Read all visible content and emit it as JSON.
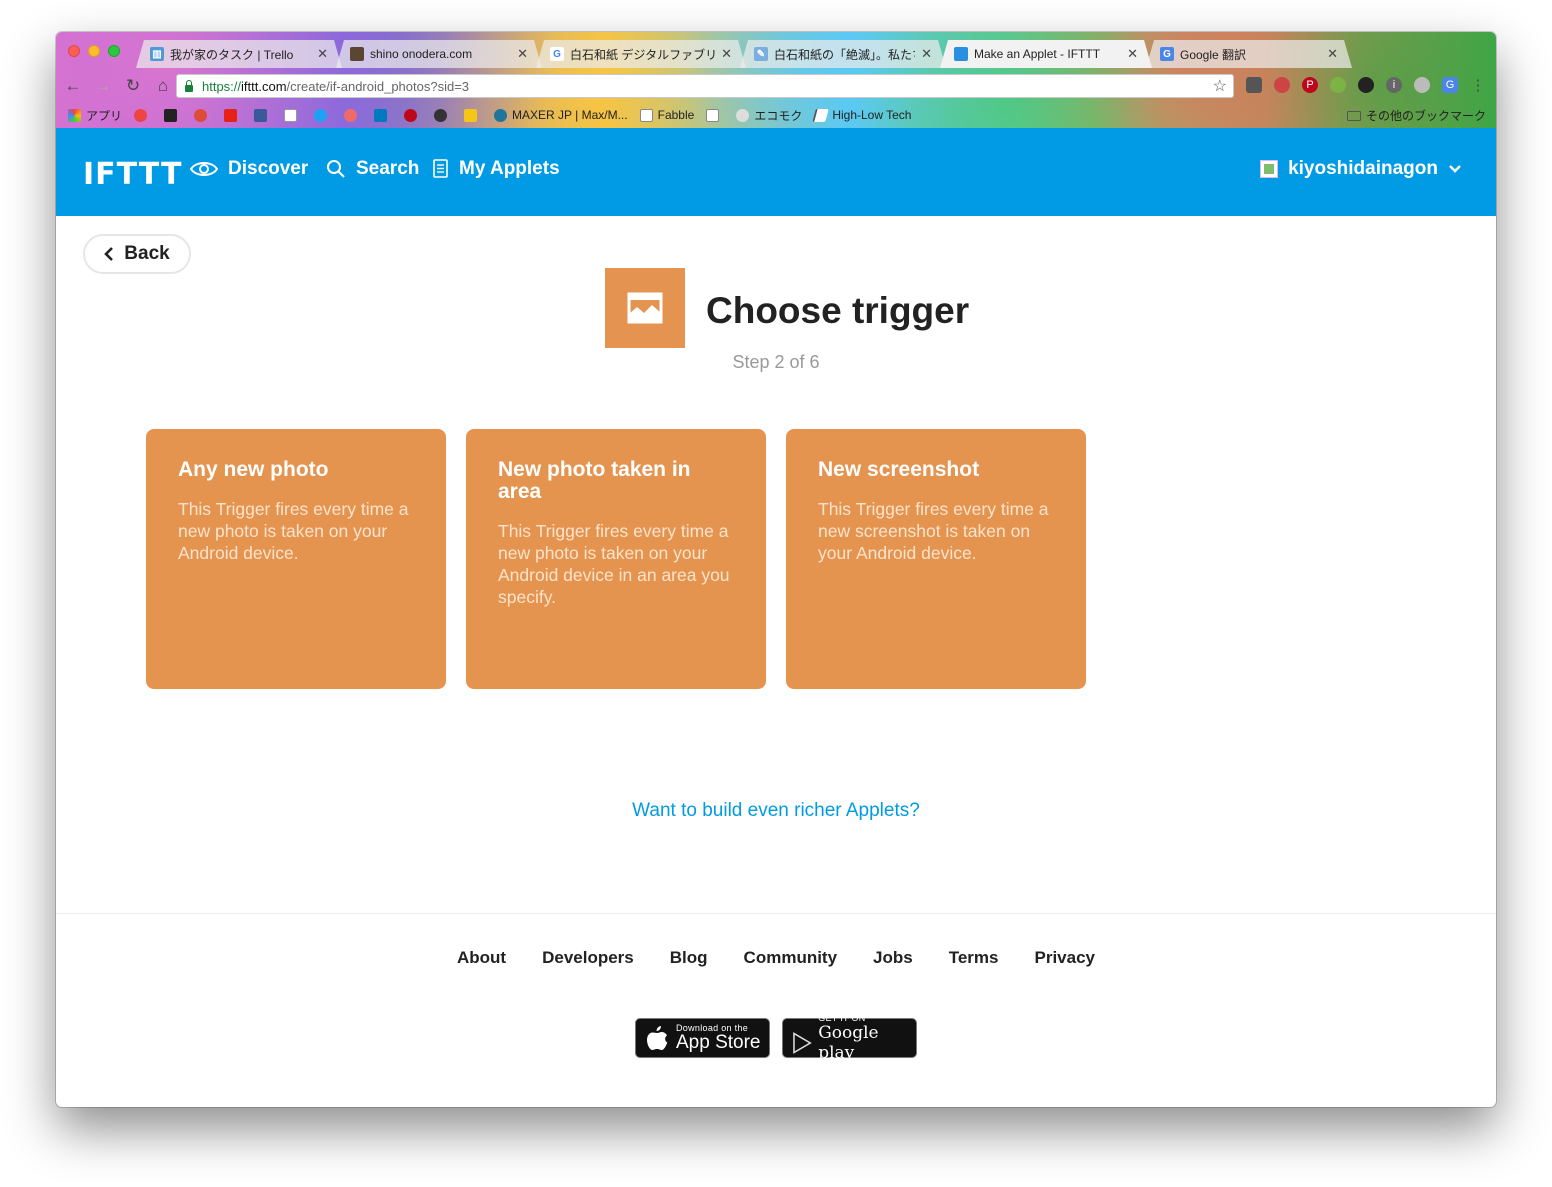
{
  "browser": {
    "tabs": [
      {
        "title": "我が家のタスク | Trello",
        "fav_color": "#4f9ad6",
        "fav_glyph": "▥"
      },
      {
        "title": "shino onodera.com",
        "fav_color": "#5a4633",
        "fav_glyph": ""
      },
      {
        "title": "白石和紙 デジタルファブリケー",
        "fav_color": "#ffffff",
        "fav_glyph": "G"
      },
      {
        "title": "白石和紙の「絶滅」。私たち",
        "fav_color": "#7aaee0",
        "fav_glyph": "✎"
      },
      {
        "title": "Make an Applet - IFTTT",
        "fav_color": "#2b8fe0",
        "fav_glyph": ""
      },
      {
        "title": "Google 翻訳",
        "fav_color": "#4a86e8",
        "fav_glyph": "G"
      }
    ],
    "url_scheme": "https://",
    "url_host": "ifttt.com",
    "url_path": "/create/if-android_photos?sid=3",
    "bookmarks": [
      {
        "label": "アプリ",
        "color": "#e54"
      },
      {
        "label": "",
        "color": "#e44"
      },
      {
        "label": "",
        "color": "#222"
      },
      {
        "label": "",
        "color": "#dd4b39"
      },
      {
        "label": "",
        "color": "#e62117"
      },
      {
        "label": "",
        "color": "#3b5998"
      },
      {
        "label": "",
        "color": "#222"
      },
      {
        "label": "",
        "color": "#1da1f2"
      },
      {
        "label": "",
        "color": "#f06a6a"
      },
      {
        "label": "",
        "color": "#0079bf"
      },
      {
        "label": "",
        "color": "#bd081c"
      },
      {
        "label": "",
        "color": "#333"
      },
      {
        "label": "",
        "color": "#f5c518"
      },
      {
        "label": "MAXER JP | Max/M...",
        "color": "#21759b"
      },
      {
        "label": "Fabble",
        "color": "#888"
      },
      {
        "label": "",
        "color": "#888"
      },
      {
        "label": "エコモク",
        "color": "#666"
      },
      {
        "label": "High-Low Tech",
        "color": "#555"
      }
    ],
    "other_bookmarks": "その他のブックマーク"
  },
  "header": {
    "logo": "IFTTT",
    "nav": [
      "Discover",
      "Search",
      "My Applets"
    ],
    "username": "kiyoshidainagon"
  },
  "main": {
    "back_label": "Back",
    "title": "Choose trigger",
    "step": "Step 2 of 6",
    "accent_color": "#e4944f",
    "triggers": [
      {
        "title": "Any new photo",
        "desc": "This Trigger fires every time a new photo is taken on your Android device."
      },
      {
        "title": "New photo taken in area",
        "desc": "This Trigger fires every time a new photo is taken on your Android device in an area you specify."
      },
      {
        "title": "New screenshot",
        "desc": "This Trigger fires every time a new screenshot is taken on your Android device."
      }
    ],
    "richer_link": "Want to build even richer Applets?"
  },
  "footer": {
    "links": [
      "About",
      "Developers",
      "Blog",
      "Community",
      "Jobs",
      "Terms",
      "Privacy"
    ],
    "app_store_small": "Download on the",
    "app_store_big": "App Store",
    "play_small": "GET IT ON",
    "play_big": "Google play"
  }
}
